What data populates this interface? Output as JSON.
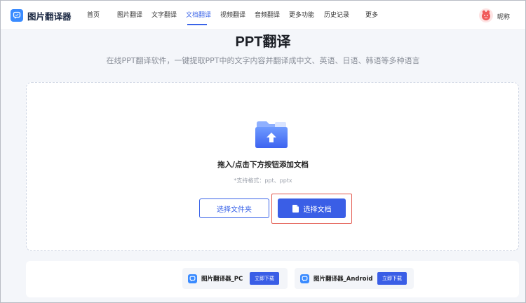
{
  "nav": {
    "logo_text": "图片翻译器",
    "items": [
      {
        "label": "首页"
      },
      {
        "label": "图片翻译"
      },
      {
        "label": "文字翻译"
      },
      {
        "label": "文档翻译"
      },
      {
        "label": "视频翻译"
      },
      {
        "label": "音频翻译"
      },
      {
        "label": "更多功能"
      },
      {
        "label": "历史记录"
      },
      {
        "label": "更多"
      }
    ],
    "active_item": "文档翻译",
    "user_name": "昵称"
  },
  "header": {
    "title": "PPT翻译",
    "subtitle": "在线PPT翻译软件，一键提取PPT中的文字内容并翻译成中文、英语、日语、韩语等多种语言"
  },
  "upload": {
    "hint": "拖入/点击下方按钮添加文档",
    "formats": "*支持格式：ppt、pptx",
    "select_folder_label": "选择文件夹",
    "select_doc_label": "选择文档"
  },
  "downloads": [
    {
      "name": "图片翻译器_PC",
      "button": "立即下载"
    },
    {
      "name": "图片翻译器_Android",
      "button": "立即下载"
    }
  ],
  "colors": {
    "accent": "#3a5ee6",
    "active_nav": "#3a64e8",
    "highlight": "#e35a4f",
    "logo": "#3a8bff"
  },
  "icons": {
    "logo": "chat-bubble-icon",
    "upload": "folder-upload-icon",
    "doc_button": "document-icon",
    "avatar": "avatar-icon"
  }
}
